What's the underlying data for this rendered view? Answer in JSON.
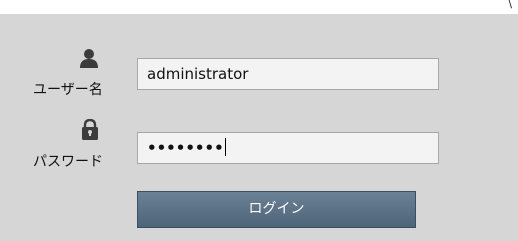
{
  "corner_mark": "\\",
  "username": {
    "label": "ユーザー名",
    "value": "administrator",
    "icon": "user-icon"
  },
  "password": {
    "label": "パスワード",
    "masked_value": "••••••••",
    "icon": "lock-icon"
  },
  "login_button": {
    "label": "ログイン"
  },
  "colors": {
    "panel_bg": "#d6d6d6",
    "input_bg": "#f3f3f3",
    "button_bg": "#56697c",
    "button_text": "#ffffff"
  }
}
